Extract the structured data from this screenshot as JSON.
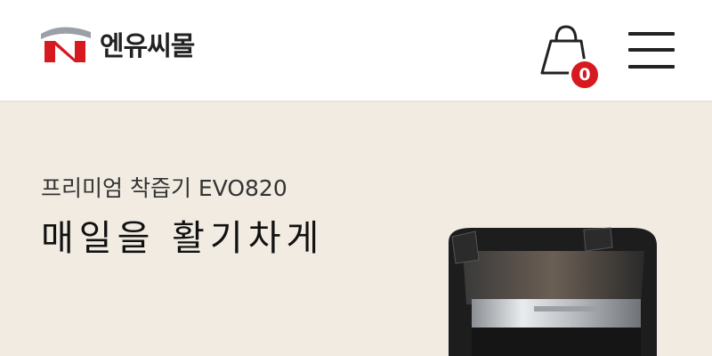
{
  "header": {
    "logo_text": "엔유씨몰",
    "cart_count": "0"
  },
  "icons": {
    "logo": "nuc-logo-icon",
    "cart": "shopping-bag-icon",
    "menu": "hamburger-menu-icon"
  },
  "colors": {
    "brand_red": "#d71920",
    "banner_bg": "#f1ebe2"
  },
  "banner": {
    "subtitle": "프리미엄 착즙기 EVO820",
    "title": "매일을 활기차게"
  }
}
